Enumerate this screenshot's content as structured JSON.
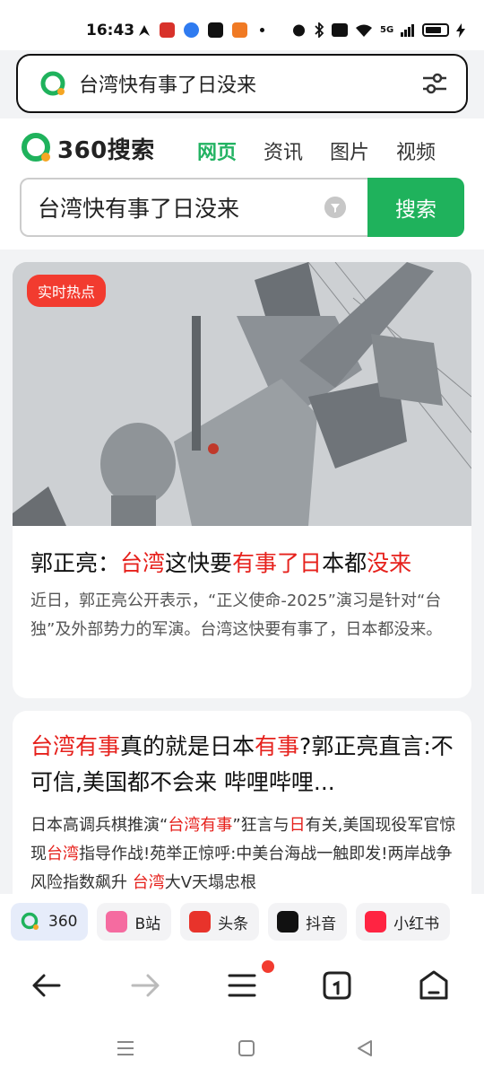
{
  "status": {
    "time": "16:43",
    "network": "5G"
  },
  "address_bar": {
    "query": "台湾快有事了日没来"
  },
  "header": {
    "brand": "360搜索",
    "tabs": [
      "网页",
      "资讯",
      "图片",
      "视频"
    ],
    "active_tab": "网页",
    "search_value": "台湾快有事了日没来",
    "search_button": "搜索"
  },
  "results": [
    {
      "badge": "实时热点",
      "title_parts": [
        "郭正亮：",
        "台湾",
        "这快要",
        "有事了日",
        "本都",
        "没来"
      ],
      "desc": "近日，郭正亮公开表示，“正义使命-2025”演习是针对“台独”及外部势力的军演。台湾这快要有事了，日本都没来。"
    },
    {
      "title_parts": [
        "台湾有事",
        "真的就是日本",
        "有事",
        "?郭正亮直言:不可信,美国都不会来 哔哩哔哩..."
      ],
      "desc_parts": [
        "日本高调兵棋推演“",
        "台湾有事",
        "”狂言与",
        "日",
        "有关,美国现役军官惊现",
        "台湾",
        "指导作战!苑举正惊呼:中美台海战一触即发!两岸战争风险指数飙升 ",
        "台湾",
        "大V天塌忠根"
      ]
    }
  ],
  "quick_links": [
    {
      "label": "360",
      "icon": "360-logo-icon"
    },
    {
      "label": "B站",
      "icon": "bilibili-icon"
    },
    {
      "label": "头条",
      "icon": "toutiao-icon"
    },
    {
      "label": "抖音",
      "icon": "douyin-icon"
    },
    {
      "label": "小红书",
      "icon": "xiaohongshu-icon"
    }
  ],
  "bottom_nav": [
    "back-icon",
    "forward-icon",
    "menu-icon",
    "tabs-icon",
    "home-icon"
  ],
  "colors": {
    "brand_green": "#1fb25c",
    "accent_red": "#e6211c",
    "badge_red": "#f23b2f"
  }
}
